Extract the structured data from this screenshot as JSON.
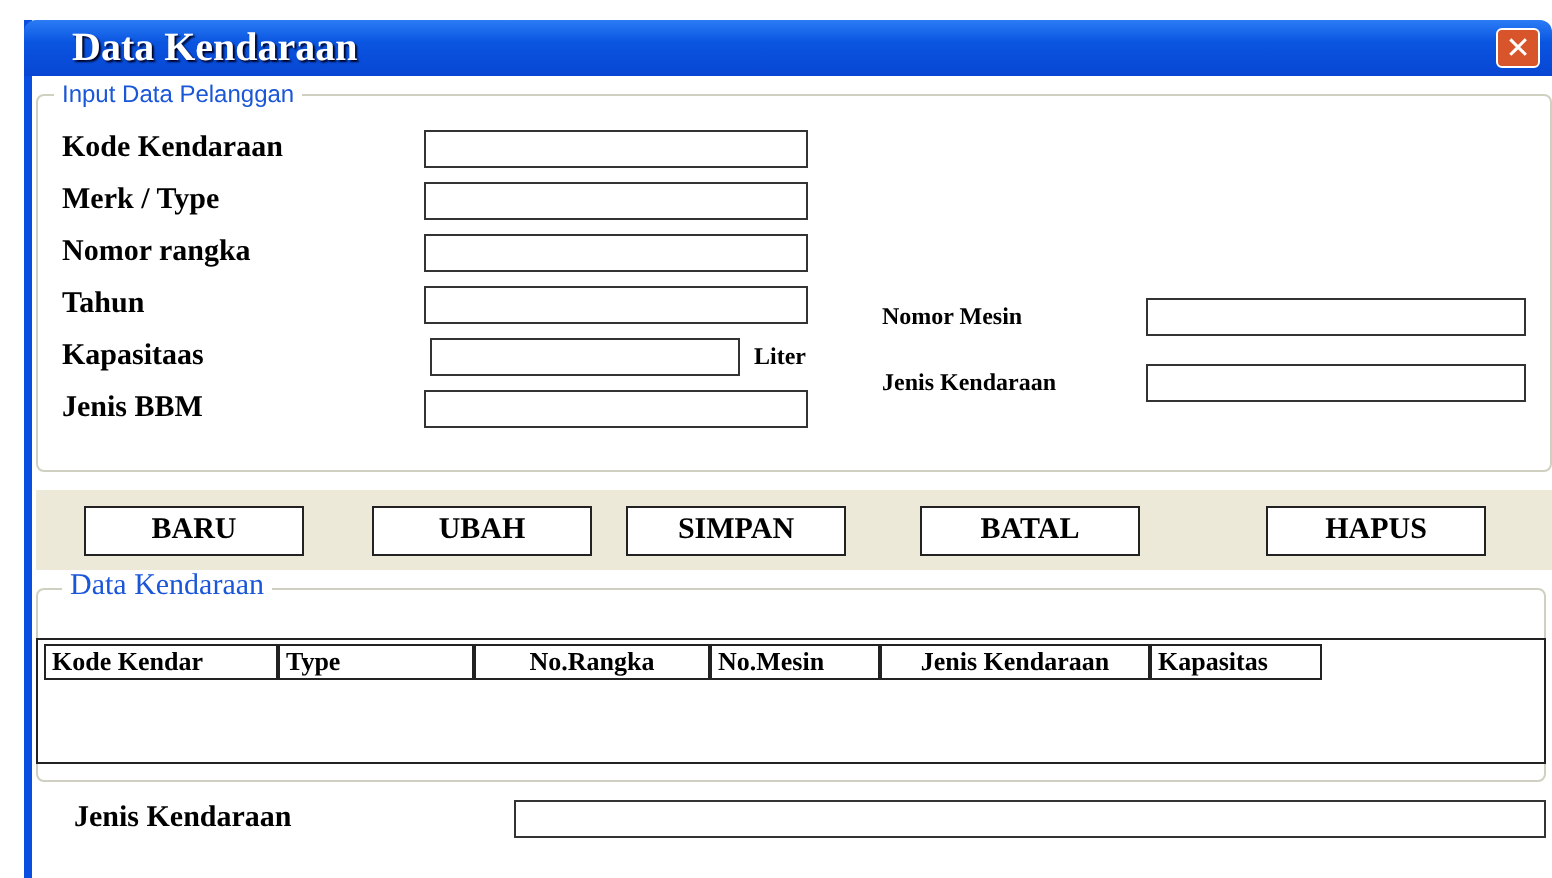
{
  "window": {
    "title": "Data Kendaraan",
    "close_icon": "✕"
  },
  "input_group": {
    "legend": "Input Data Pelanggan",
    "left_fields": [
      {
        "label": "Kode Kendaraan"
      },
      {
        "label": "Merk / Type"
      },
      {
        "label": "Nomor rangka"
      },
      {
        "label": "Tahun"
      },
      {
        "label": "Kapasitaas",
        "unit": "Liter"
      },
      {
        "label": "Jenis BBM"
      }
    ],
    "right_fields": [
      {
        "label": "Nomor Mesin"
      },
      {
        "label": "Jenis Kendaraan"
      }
    ]
  },
  "buttons": [
    "BARU",
    "UBAH",
    "SIMPAN",
    "BATAL",
    "HAPUS"
  ],
  "table_group": {
    "legend": "Data Kendaraan",
    "table": {
      "columns": [
        "Kode Kendar",
        "Type",
        "No.Rangka",
        "No.Mesin",
        "Jenis Kendaraan",
        "Kapasitas"
      ]
    }
  },
  "bottom_field": {
    "label": "Jenis Kendaraan"
  }
}
